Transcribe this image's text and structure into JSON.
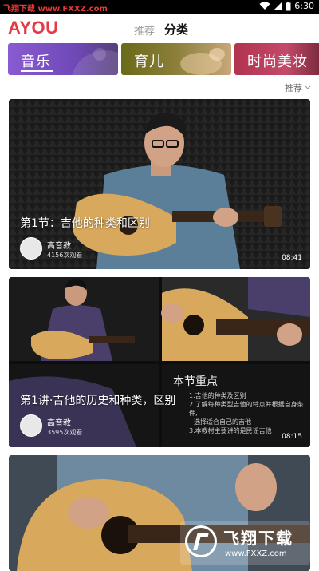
{
  "status_bar": {
    "watermark": "飞翔下载 www.FXXZ.com",
    "time": "6:30"
  },
  "header": {
    "logo": "AYOU",
    "tabs": [
      {
        "label": "推荐",
        "active": false
      },
      {
        "label": "分类",
        "active": true
      }
    ]
  },
  "categories": [
    {
      "label": "音乐",
      "selected": true
    },
    {
      "label": "育儿",
      "selected": false
    },
    {
      "label": "时尚美妆",
      "selected": false
    }
  ],
  "sort": {
    "label": "推荐"
  },
  "videos": [
    {
      "title": "第1节：吉他的种类和区别",
      "author": "高音教",
      "views": "4156次观看",
      "duration": "08:41"
    },
    {
      "title": "第1讲·吉他的历史和种类，区别",
      "author": "高音教",
      "views": "3595次观看",
      "duration": "08:15",
      "overlay_heading": "本节重点",
      "overlay_lines": [
        "1.吉他的种类及区别",
        "2.了解每种类型吉他的特点并根据自身条件,",
        "选择适合自己的吉他",
        "3.本教材主要讲的是民谣吉他"
      ]
    },
    {}
  ],
  "watermark": {
    "brand": "飞翔下载",
    "url": "www.FXXZ.com"
  },
  "colors": {
    "accent": "#e53945"
  }
}
